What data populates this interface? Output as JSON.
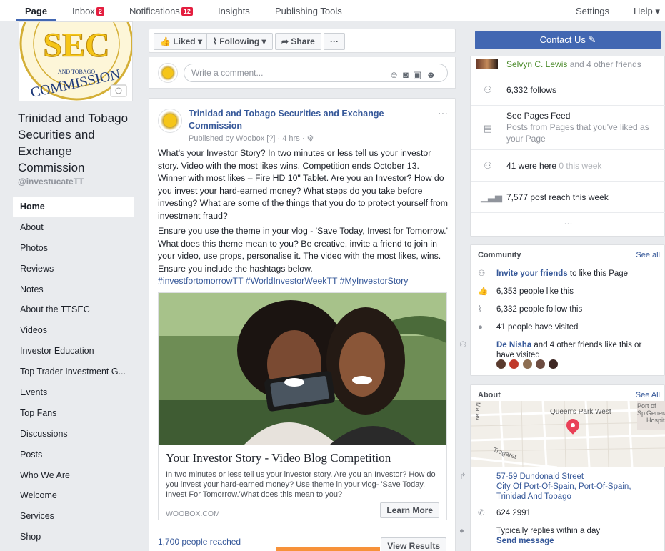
{
  "topnav": {
    "page": "Page",
    "inbox": "Inbox",
    "inbox_badge": "2",
    "notifications": "Notifications",
    "notifications_badge": "12",
    "insights": "Insights",
    "publishing_tools": "Publishing Tools",
    "settings": "Settings",
    "help": "Help ▾"
  },
  "profile": {
    "name": "Trinidad and Tobago Securities and Exchange Commission",
    "handle": "@investucateTT"
  },
  "leftnav": {
    "items": [
      "Home",
      "About",
      "Photos",
      "Reviews",
      "Notes",
      "About the TTSEC",
      "Videos",
      "Investor Education",
      "Top Trader Investment G...",
      "Events",
      "Top Fans",
      "Discussions",
      "Posts",
      "Who We Are",
      "Welcome",
      "Services",
      "Shop"
    ]
  },
  "actions": {
    "liked": "Liked ▾",
    "following": "Following ▾",
    "share": "Share",
    "more": "···"
  },
  "comment": {
    "placeholder": "Write a comment..."
  },
  "post": {
    "author": "Trinidad and Tobago Securities and Exchange Commission",
    "meta": "Published by Woobox [?] · 4 hrs · ⚙",
    "paragraph1": "What's your Investor Story? In two minutes or less tell us your investor story. Video with the most likes wins. Competition ends October 13. Winner with most likes – Fire HD 10\" Tablet. Are you an Investor? How do you invest your hard-earned money? What steps do you take before investing? What are some of the things that you do to protect yourself from investment fraud?",
    "paragraph2": "Ensure you use the theme in your vlog - 'Save Today, Invest for Tomorrow.' What does this theme mean to you? Be creative, invite a friend to join in your video, use props, personalise it. The video with the most likes, wins. Ensure you include the hashtags below.",
    "hashtags": "#investfortomorrowTT #WorldInvestorWeekTT #MyInvestorStory",
    "card_title": "Your Investor Story - Video Blog Competition",
    "card_desc": "In two minutes or less tell us your investor story. Are you an Investor? How do you invest your hard-earned money? Use theme in your vlog- 'Save Today, Invest For Tomorrow.'What does this mean to you?",
    "card_domain": "WOOBOX.COM",
    "learn_more": "Learn More",
    "reach": "1,700 people reached",
    "view_results": "View Results"
  },
  "right": {
    "contact": "Contact Us ✎",
    "friends_like_name": "Selvyn C. Lewis",
    "friends_like_rest": " and 4 other friends",
    "follows": "6,332 follows",
    "feed_title": "See Pages Feed",
    "feed_desc": "Posts from Pages that you've liked as your Page",
    "were_here": "41 were here",
    "were_here_week": " 0 this week",
    "post_reach": "7,577 post reach this week",
    "dots": "···"
  },
  "community": {
    "title": "Community",
    "see_all": "See all",
    "invite_link": "Invite your friends",
    "invite_rest": " to like this Page",
    "likes": "6,353 people like this",
    "follow": "6,332 people follow this",
    "visited": "41 people have visited",
    "friend_name": "De Nisha",
    "friend_rest": " and 4 other friends like this or have visited"
  },
  "about": {
    "title": "About",
    "see_all": "See All",
    "map_label_1": "Queen's Park West",
    "map_label_2": "Port of Sp",
    "map_label_3": "Genera",
    "map_label_4": "Hospita",
    "map_label_5": "Tragaret",
    "map_label_6": "Marav",
    "address_1": "57-59 Dundonald Street",
    "address_2": "City Of Port-Of-Spain, Port-Of-Spain, Trinidad And Tobago",
    "phone": "624 2991",
    "replies": "Typically replies within a day",
    "send_message": "Send message"
  },
  "colors": {
    "brand_blue": "#4267b2",
    "link": "#365899",
    "badge_red": "#e41e3f",
    "pin": "#e94057"
  }
}
